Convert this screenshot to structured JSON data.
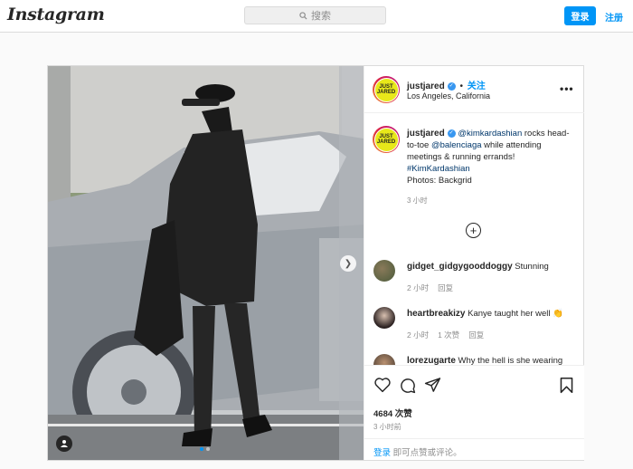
{
  "header": {
    "logo": "Instagram",
    "search_placeholder": "搜索",
    "login_label": "登录",
    "signup_label": "注册"
  },
  "post": {
    "author": {
      "username": "justjared",
      "follow_label": "关注",
      "location": "Los Angeles, California",
      "avatar_text": "JUST JARED"
    },
    "caption": {
      "username": "justjared",
      "mention_1": "@kimkardashian",
      "text_1": " rocks head-to-toe ",
      "mention_2": "@balenciaga",
      "text_2": " while attending meetings & running errands!",
      "hashtag": "#KimKardashian",
      "credit": "Photos: Backgrid",
      "time": "3 小时"
    },
    "comments": [
      {
        "username": "gidget_gidgygooddoggy",
        "text": "Stunning",
        "time": "2 小时",
        "likes": "",
        "reply_label": "回复"
      },
      {
        "username": "heartbreakizy",
        "text": "Kanye taught her well 👏",
        "time": "2 小时",
        "likes": "1 次赞",
        "reply_label": "回复"
      },
      {
        "username": "lorezugarte",
        "text": "Why the hell is she wearing",
        "time": "",
        "likes": "",
        "reply_label": ""
      }
    ],
    "likes_count": "4684 次赞",
    "posted_time": "3 小时前",
    "login_prompt_link": "登录",
    "login_prompt_text": " 即可点赞或评论。"
  },
  "icons": [
    "search-icon",
    "verified-icon",
    "more-icon",
    "add-comment-icon",
    "heart-icon",
    "comment-icon",
    "share-icon",
    "bookmark-icon",
    "chevron-right-icon",
    "user-tag-icon"
  ],
  "colors": {
    "accent": "#0095f6",
    "text": "#262626",
    "muted": "#8e8e8e",
    "link": "#00376b"
  }
}
